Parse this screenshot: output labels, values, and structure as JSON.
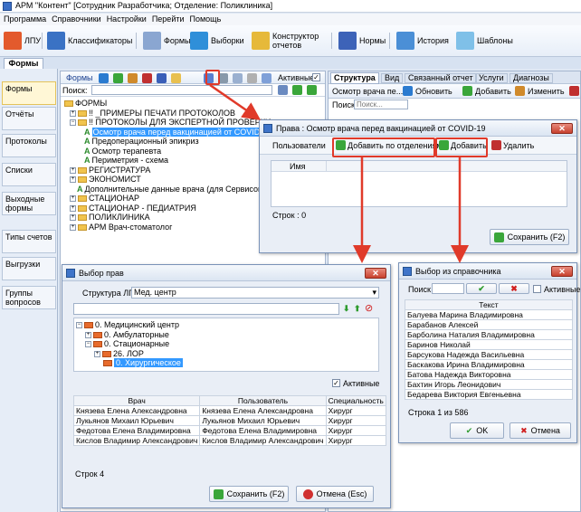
{
  "window": {
    "title": "АРМ \"Контент\" [Сотрудник Разработчика; Отделение: Поликлиника]"
  },
  "menu": [
    "Программа",
    "Справочники",
    "Настройки",
    "Перейти",
    "Помощь"
  ],
  "toolbar": {
    "lpu": "ЛПУ",
    "classifiers": "Классификаторы",
    "forms": "Формы",
    "selections": "Выборки",
    "constructor1": "Конструктор",
    "constructor2": "отчетов",
    "norms": "Нормы",
    "history": "История",
    "templates": "Шаблоны"
  },
  "doc_tab": "Формы",
  "sidebar": [
    "Формы",
    "Отчёты",
    "Протоколы",
    "Списки",
    "Выходные формы",
    "Типы счетов",
    "Выгрузки",
    "Группы вопросов"
  ],
  "forms_panel": {
    "title": "Формы",
    "active_label": "Активные",
    "search_label": "Поиск:"
  },
  "tree": [
    {
      "label": "ФОРМЫ",
      "kind": "root"
    },
    {
      "label": "!! _ПРИМЕРЫ ПЕЧАТИ ПРОТОКОЛОВ",
      "kind": "folder"
    },
    {
      "label": "!! ПРОТОКОЛЫ ДЛЯ ЭКСПЕРТНОЙ ПРОВЕРКИ",
      "kind": "folder"
    },
    {
      "label": "Осмотр врача перед вакцинацией от COVID-19",
      "kind": "leaf",
      "selected": true
    },
    {
      "label": "Предоперационный эпикриз",
      "kind": "leaf"
    },
    {
      "label": "Осмотр терапевта",
      "kind": "leaf"
    },
    {
      "label": "Периметрия - схема",
      "kind": "leaf"
    },
    {
      "label": "РЕГИСТРАТУРА",
      "kind": "folder"
    },
    {
      "label": "ЭКОНОМИСТ",
      "kind": "folder"
    },
    {
      "label": "Дополнительные данные врача (для Сервисов)",
      "kind": "leaf"
    },
    {
      "label": "СТАЦИОНАР",
      "kind": "folder"
    },
    {
      "label": "СТАЦИОНАР - ПЕДИАТРИЯ",
      "kind": "folder"
    },
    {
      "label": "ПОЛИКЛИНИКА",
      "kind": "folder"
    },
    {
      "label": "АРМ Врач-стоматолог",
      "kind": "folder"
    }
  ],
  "right_panel": {
    "tabs": [
      "Структура",
      "Вид",
      "Связанный отчет",
      "Услуги",
      "Диагнозы"
    ],
    "selected": "Осмотр врача пе...",
    "refresh": "Обновить",
    "add": "Добавить",
    "edit": "Изменить",
    "search_label": "Поиск",
    "search_placeholder": "Поиск..."
  },
  "rights_dialog": {
    "title": "Права : Осмотр врача перед вакцинацией от COVID-19",
    "tab_users": "Пользователи",
    "add_by_dept": "Добавить по отделениям",
    "add": "Добавить",
    "delete": "Удалить",
    "col_name": "Имя",
    "rows": "Строк : 0",
    "save": "Сохранить (F2)"
  },
  "select_rights": {
    "title": "Выбор прав",
    "structure_label": "Структура ЛПУ",
    "structure_value": "Мед. центр",
    "tree": [
      "0. Медицинский центр",
      "0. Амбулаторные",
      "0. Стационарные",
      "26. ЛОР",
      "0. Хирургическое"
    ],
    "active": "Активные",
    "columns": [
      "Врач",
      "Пользователь",
      "Специальность"
    ],
    "rows": [
      [
        "Князева Елена Александровна",
        "Князева Елена Александровна",
        "Хирург"
      ],
      [
        "Лукьянов Михаил Юрьевич",
        "Лукьянов Михаил Юрьевич",
        "Хирург"
      ],
      [
        "Федотова Елена Владимировна",
        "Федотова Елена Владимировна",
        "Хирург"
      ],
      [
        "Кислов Владимир Александрович",
        "Кислов Владимир Александрович",
        "Хирург"
      ]
    ],
    "count": "Строк 4",
    "save": "Сохранить (F2)",
    "cancel": "Отмена (Esc)"
  },
  "ref_dialog": {
    "title": "Выбор из справочника",
    "search_label": "Поиск",
    "active": "Активные",
    "column": "Текст",
    "rows": [
      "Балуева Марина Владимировна",
      "Барабанов Алексей",
      "Барболина Наталия Владимировна",
      "Баринов Николай",
      "Барсукова Надежда Васильевна",
      "Баскакова Ирина Владимировна",
      "Батова Надежда Викторовна",
      "Бахтин Игорь Леонидович",
      "Бедарева Виктория Евгеньевна"
    ],
    "count": "Строка 1 из 586",
    "ok": "OK",
    "cancel": "Отмена"
  },
  "colors": {
    "highlight": "#e03a2a",
    "selection": "#3399ff"
  }
}
